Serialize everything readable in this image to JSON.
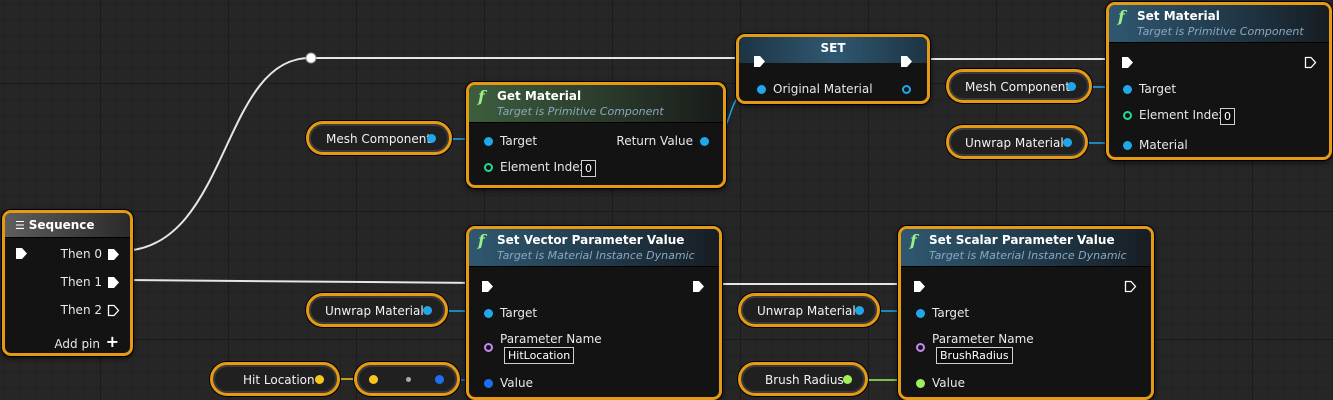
{
  "nodes": {
    "sequence": {
      "title": "Sequence",
      "outputs": [
        "Then 0",
        "Then 1",
        "Then 2"
      ],
      "add_pin": "Add pin"
    },
    "set": {
      "title": "SET",
      "pin": "Original Material"
    },
    "get_material": {
      "title": "Get Material",
      "subtitle": "Target is Primitive Component",
      "target": "Target",
      "element_index": "Element Index",
      "element_index_value": "0",
      "return_value": "Return Value"
    },
    "set_material": {
      "title": "Set Material",
      "subtitle": "Target is Primitive Component",
      "target": "Target",
      "element_index": "Element Index",
      "element_index_value": "0",
      "material": "Material"
    },
    "set_vector": {
      "title": "Set Vector Parameter Value",
      "subtitle": "Target is Material Instance Dynamic",
      "target": "Target",
      "parameter_name": "Parameter Name",
      "parameter_value": "HitLocation",
      "value": "Value"
    },
    "set_scalar": {
      "title": "Set Scalar Parameter Value",
      "subtitle": "Target is Material Instance Dynamic",
      "target": "Target",
      "parameter_name": "Parameter Name",
      "parameter_value": "BrushRadius",
      "value": "Value"
    }
  },
  "variables": {
    "mesh_component_1": "Mesh Component",
    "mesh_component_2": "Mesh Component",
    "unwrap_material_1": "Unwrap Material",
    "unwrap_material_2": "Unwrap Material",
    "unwrap_material_3": "Unwrap Material",
    "hit_location": "Hit Location",
    "brush_radius": "Brush Radius"
  },
  "colors": {
    "selection": "#e59a16",
    "object_pin": "#1fa7ea",
    "integer_pin": "#1fdc93",
    "name_pin": "#c68af0",
    "vector_pin": "#f5c61d",
    "float_pin": "#9ef05b",
    "exec_wire": "#e6e6e6"
  }
}
